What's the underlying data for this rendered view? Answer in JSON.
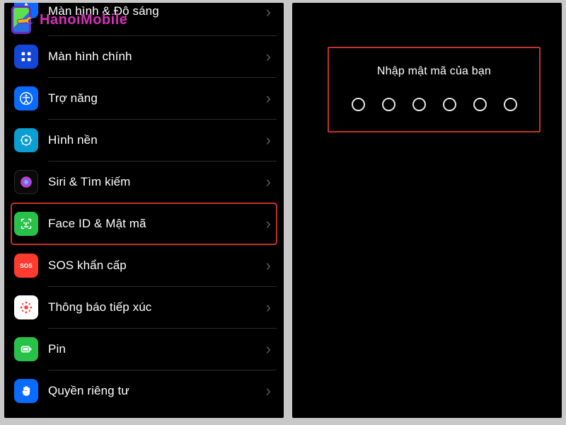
{
  "watermark": {
    "text": "HanoiMobile"
  },
  "settings": {
    "items": [
      {
        "label": "Màn hình & Độ sáng"
      },
      {
        "label": "Màn hình chính"
      },
      {
        "label": "Trợ năng"
      },
      {
        "label": "Hình nền"
      },
      {
        "label": "Siri & Tìm kiếm"
      },
      {
        "label": "Face ID & Mật mã"
      },
      {
        "label": "SOS khẩn cấp"
      },
      {
        "label": "Thông báo tiếp xúc"
      },
      {
        "label": "Pin"
      },
      {
        "label": "Quyền riêng tư"
      }
    ],
    "highlighted_index": 5
  },
  "passcode": {
    "title": "Nhập mật mã của bạn",
    "digit_count": 6
  },
  "colors": {
    "highlight_border": "#c23329",
    "text": "#ffffff",
    "chevron": "#5a5a5f"
  }
}
